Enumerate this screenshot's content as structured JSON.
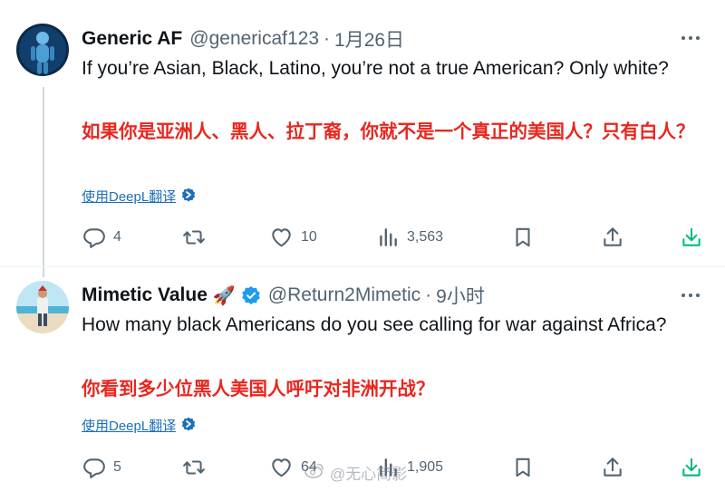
{
  "tweets": [
    {
      "name": "Generic AF",
      "handle": "@genericaf123",
      "separator": "·",
      "time": "1月26日",
      "text_en": "If you’re Asian, Black, Latino, you’re not a true American? Only white?",
      "text_zh": "如果你是亚洲人、黑人、拉丁裔，你就不是一个真正的美国人？只有白人？",
      "translate_label": "使用DeepL翻译",
      "stats": {
        "replies": "4",
        "retweets": "",
        "likes": "10",
        "views": "3,563"
      }
    },
    {
      "name": "Mimetic Value",
      "name_emoji": "🚀",
      "handle": "@Return2Mimetic",
      "separator": "·",
      "time": "9小时",
      "text_en": "How many black Americans do you see calling for war against Africa?",
      "text_zh": "你看到多少位黑人美国人呼吁对非洲开战？",
      "translate_label": "使用DeepL翻译",
      "stats": {
        "replies": "5",
        "retweets": "",
        "likes": "64",
        "views": "1,905"
      }
    }
  ],
  "watermark": "@无心简影",
  "colors": {
    "accent": "#1d9bf0",
    "translation_text": "#e8271f",
    "muted": "#536471",
    "download_icon": "#00ba7c"
  },
  "icons": [
    "reply-icon",
    "retweet-icon",
    "like-icon",
    "views-icon",
    "bookmark-icon",
    "share-icon",
    "download-icon",
    "verified-badge-icon",
    "more-options-icon"
  ]
}
